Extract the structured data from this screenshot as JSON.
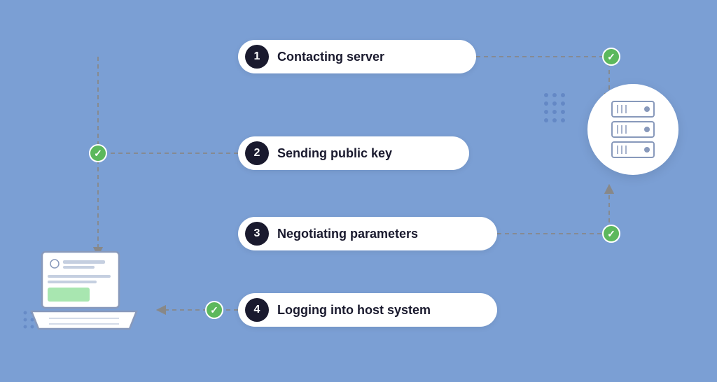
{
  "background_color": "#7b9fd4",
  "steps": [
    {
      "number": "1",
      "label": "Contacting server"
    },
    {
      "number": "2",
      "label": "Sending public key"
    },
    {
      "number": "3",
      "label": "Negotiating parameters"
    },
    {
      "number": "4",
      "label": "Logging into host system"
    }
  ],
  "check_symbol": "✓",
  "accent_green": "#5cb85c",
  "accent_dark": "#1a1a2e"
}
